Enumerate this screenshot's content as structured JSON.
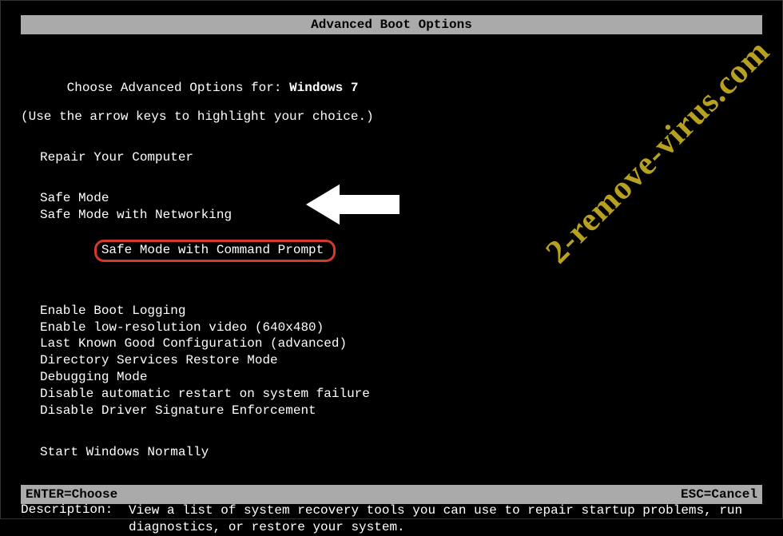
{
  "title": "Advanced Boot Options",
  "instructions": {
    "prefix": "Choose Advanced Options for: ",
    "os_name": "Windows 7",
    "hint": "(Use the arrow keys to highlight your choice.)"
  },
  "menu": {
    "repair": "Repair Your Computer",
    "group1": [
      "Safe Mode",
      "Safe Mode with Networking",
      "Safe Mode with Command Prompt"
    ],
    "group2": [
      "Enable Boot Logging",
      "Enable low-resolution video (640x480)",
      "Last Known Good Configuration (advanced)",
      "Directory Services Restore Mode",
      "Debugging Mode",
      "Disable automatic restart on system failure",
      "Disable Driver Signature Enforcement"
    ],
    "group3": [
      "Start Windows Normally"
    ]
  },
  "description": {
    "label": "Description:",
    "text": "View a list of system recovery tools you can use to repair startup problems, run diagnostics, or restore your system."
  },
  "footer": {
    "enter": "ENTER=Choose",
    "esc": "ESC=Cancel"
  },
  "watermark": "2-remove-virus.com"
}
